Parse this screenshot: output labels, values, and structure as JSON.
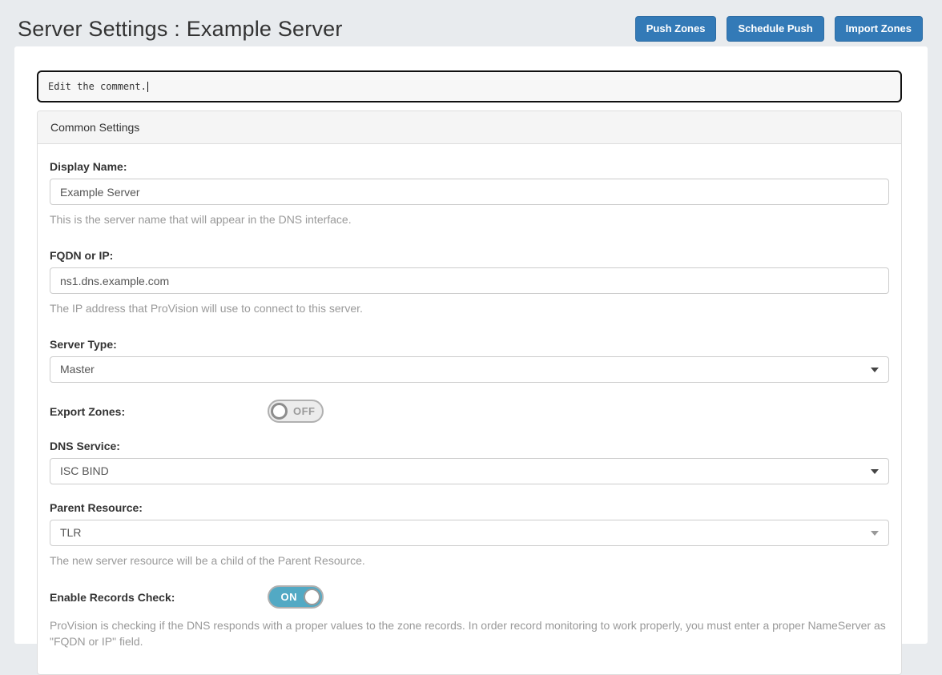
{
  "page": {
    "title": "Server Settings : Example Server"
  },
  "header": {
    "buttons": [
      {
        "label": "Push Zones"
      },
      {
        "label": "Schedule Push"
      },
      {
        "label": "Import Zones"
      }
    ]
  },
  "comment": {
    "value": "Edit the comment."
  },
  "panel": {
    "title": "Common Settings"
  },
  "fields": {
    "display_name": {
      "label": "Display Name:",
      "value": "Example Server",
      "help": "This is the server name that will appear in the DNS interface."
    },
    "fqdn": {
      "label": "FQDN or IP:",
      "value": "ns1.dns.example.com",
      "help": "The IP address that ProVision will use to connect to this server."
    },
    "server_type": {
      "label": "Server Type:",
      "value": "Master"
    },
    "export_zones": {
      "label": "Export Zones:",
      "state": "OFF"
    },
    "dns_service": {
      "label": "DNS Service:",
      "value": "ISC BIND"
    },
    "parent_resource": {
      "label": "Parent Resource:",
      "value": "TLR",
      "help": "The new server resource will be a child of the Parent Resource."
    },
    "enable_records_check": {
      "label": "Enable Records Check:",
      "state": "ON",
      "help": "ProVision is checking if the DNS responds with a proper values to the zone records. In order record monitoring to work properly, you must enter a proper NameServer as \"FQDN or IP\" field."
    }
  },
  "colors": {
    "accent_blue": "#337ab7",
    "toggle_on": "#52a9c4",
    "page_background": "#e8ebee"
  }
}
